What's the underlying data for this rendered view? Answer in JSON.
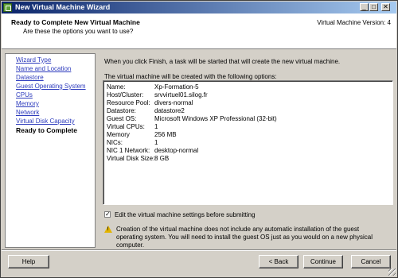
{
  "window": {
    "title": "New Virtual Machine Wizard",
    "minimize": "_",
    "maximize": "□",
    "close": "✕"
  },
  "header": {
    "title": "Ready to Complete New Virtual Machine",
    "subtitle": "Are these the options you want to use?",
    "version": "Virtual Machine Version: 4"
  },
  "sidebar": {
    "items": [
      {
        "label": "Wizard Type"
      },
      {
        "label": "Name and Location"
      },
      {
        "label": "Datastore"
      },
      {
        "label": "Guest Operating System"
      },
      {
        "label": "CPUs"
      },
      {
        "label": "Memory"
      },
      {
        "label": "Network"
      },
      {
        "label": "Virtual Disk Capacity"
      },
      {
        "label": "Ready to Complete"
      }
    ]
  },
  "main": {
    "intro": "When you click Finish, a task will be started that will create the new virtual machine.",
    "panel_label": "The virtual machine will be created with the following options:",
    "options": [
      {
        "key": "Name:",
        "value": "Xp-Formation-5"
      },
      {
        "key": "Host/Cluster:",
        "value": "srvvirtuel01.silog.fr"
      },
      {
        "key": "Resource Pool:",
        "value": "divers-normal"
      },
      {
        "key": "Datastore:",
        "value": "datastore2"
      },
      {
        "key": "Guest OS:",
        "value": "Microsoft Windows XP Professional (32-bit)"
      },
      {
        "key": "Virtual CPUs:",
        "value": "1"
      },
      {
        "key": "Memory",
        "value": "256 MB"
      },
      {
        "key": "NICs:",
        "value": "1"
      },
      {
        "key": "NIC 1 Network:",
        "value": "desktop-normal"
      },
      {
        "key": "Virtual Disk Size:",
        "value": "8 GB"
      }
    ],
    "edit_settings": {
      "label": "Edit the virtual machine settings before submitting",
      "checked": true,
      "mark": "✓"
    },
    "warning": {
      "icon": "warning-icon",
      "mark": "!",
      "text": "Creation of the virtual machine does not include any automatic installation of the guest operating system. You will need to install the guest OS just as you would on a new physical computer."
    }
  },
  "footer": {
    "help": "Help",
    "back": "< Back",
    "continue": "Continue",
    "cancel": "Cancel"
  }
}
